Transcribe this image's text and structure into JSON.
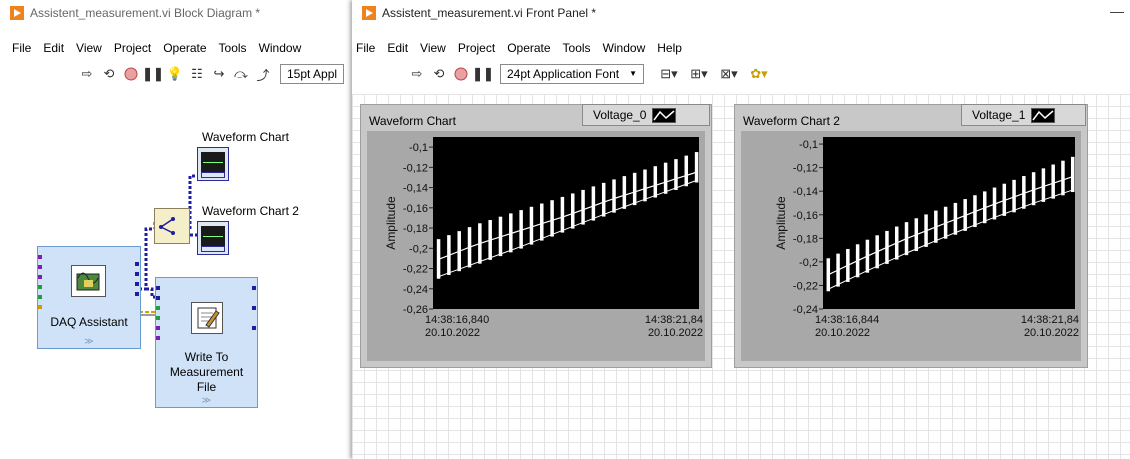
{
  "block_diagram": {
    "title": "Assistent_measurement.vi Block Diagram *",
    "menu": [
      "File",
      "Edit",
      "View",
      "Project",
      "Operate",
      "Tools",
      "Window"
    ],
    "font_select": "15pt Appl",
    "terminals": [
      {
        "label": "Waveform Chart",
        "icon": "waveform-chart-terminal-icon"
      },
      {
        "label": "Waveform Chart 2",
        "icon": "waveform-chart-terminal-icon"
      }
    ],
    "nodes": {
      "daq_label": "DAQ Assistant",
      "write_label": "Write To Measurement File"
    }
  },
  "front_panel": {
    "title": "Assistent_measurement.vi Front Panel *",
    "menu": [
      "File",
      "Edit",
      "View",
      "Project",
      "Operate",
      "Tools",
      "Window",
      "Help"
    ],
    "font_select": "24pt Application Font",
    "min_glyph": "—"
  },
  "colors": {
    "plot_bg": "#000000",
    "trace": "#ffffff",
    "node_fill": "#cfe2f7",
    "wire_dynamic": "#1e1ea0",
    "wire_path": "#d4c88a",
    "labview_orange": "#f0821e"
  },
  "chart_data": [
    {
      "type": "line",
      "label": "Waveform Chart",
      "series": [
        {
          "name": "Voltage_0"
        }
      ],
      "ylabel": "Amplitude",
      "y_ticks": [
        "-0,1",
        "-0,12",
        "-0,14",
        "-0,16",
        "-0,18",
        "-0,2",
        "-0,22",
        "-0,24",
        "-0,26"
      ],
      "ylim": [
        -0.26,
        -0.09
      ],
      "x_start": [
        "14:38:16,840",
        "20.10.2022"
      ],
      "x_end": [
        "14:38:21,84",
        "20.10.2022"
      ],
      "envelope_low": [
        -0.213,
        -0.196,
        -0.182,
        -0.168,
        -0.152,
        -0.138,
        -0.124
      ],
      "envelope_high": [
        -0.232,
        -0.216,
        -0.2,
        -0.183,
        -0.166,
        -0.15,
        -0.134
      ],
      "envelope_top": [
        -0.193,
        -0.176,
        -0.162,
        -0.148,
        -0.133,
        -0.119,
        -0.104
      ],
      "grid": false
    },
    {
      "type": "line",
      "label": "Waveform Chart 2",
      "series": [
        {
          "name": "Voltage_1"
        }
      ],
      "ylabel": "Amplitude",
      "y_ticks": [
        "-0,1",
        "-0,12",
        "-0,14",
        "-0,16",
        "-0,18",
        "-0,2",
        "-0,22",
        "-0,24"
      ],
      "ylim": [
        -0.24,
        -0.094
      ],
      "x_start": [
        "14:38:16,844",
        "20.10.2022"
      ],
      "x_end": [
        "14:38:21,84",
        "20.10.2022"
      ],
      "envelope_low": [
        -0.213,
        -0.196,
        -0.18,
        -0.166,
        -0.152,
        -0.139,
        -0.127
      ],
      "envelope_high": [
        -0.227,
        -0.21,
        -0.194,
        -0.179,
        -0.165,
        -0.152,
        -0.14
      ],
      "envelope_top": [
        -0.199,
        -0.182,
        -0.166,
        -0.152,
        -0.138,
        -0.124,
        -0.11
      ],
      "grid": false
    }
  ]
}
